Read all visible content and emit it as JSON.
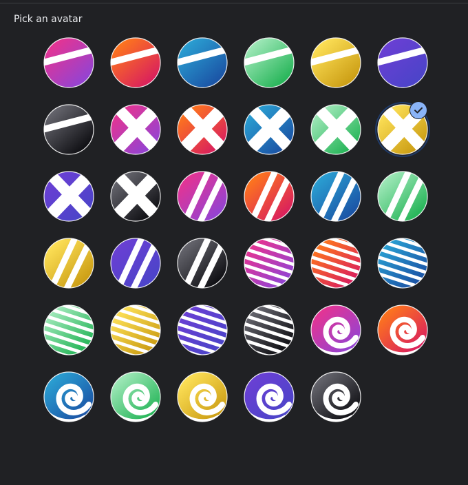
{
  "dialog": {
    "title": "Pick an avatar"
  },
  "colors": {
    "background": "#202124",
    "divider": "#3c4043",
    "title_text": "#e8eaed",
    "selection_ring": "#1f3b6b",
    "check_badge": "#8ab4f8"
  },
  "palettes": {
    "magenta": [
      "#e9338f",
      "#8e44d6"
    ],
    "red": [
      "#ff7a1a",
      "#d81b60"
    ],
    "blue": [
      "#2ba3d4",
      "#1a4fa3"
    ],
    "green": [
      "#a6ebbe",
      "#1fb253"
    ],
    "yellow": [
      "#ffe35a",
      "#c99a11"
    ],
    "violet": [
      "#6b3fd4",
      "#4a44c8"
    ],
    "black": [
      "#6a6a72",
      "#0b0b0f"
    ]
  },
  "avatars": [
    {
      "pattern": "diagonal-band",
      "palette": "magenta",
      "selected": false
    },
    {
      "pattern": "diagonal-band",
      "palette": "red",
      "selected": false
    },
    {
      "pattern": "diagonal-band",
      "palette": "blue",
      "selected": false
    },
    {
      "pattern": "diagonal-band",
      "palette": "green",
      "selected": false
    },
    {
      "pattern": "diagonal-band",
      "palette": "yellow",
      "selected": false
    },
    {
      "pattern": "diagonal-band",
      "palette": "violet",
      "selected": false
    },
    {
      "pattern": "diagonal-band",
      "palette": "black",
      "selected": false
    },
    {
      "pattern": "cross",
      "palette": "magenta",
      "selected": false
    },
    {
      "pattern": "cross",
      "palette": "red",
      "selected": false
    },
    {
      "pattern": "cross",
      "palette": "blue",
      "selected": false
    },
    {
      "pattern": "cross",
      "palette": "green",
      "selected": false
    },
    {
      "pattern": "cross",
      "palette": "yellow",
      "selected": true
    },
    {
      "pattern": "cross",
      "palette": "violet",
      "selected": false
    },
    {
      "pattern": "cross",
      "palette": "black",
      "selected": false
    },
    {
      "pattern": "double-stripe",
      "palette": "magenta",
      "selected": false
    },
    {
      "pattern": "double-stripe",
      "palette": "red",
      "selected": false
    },
    {
      "pattern": "double-stripe",
      "palette": "blue",
      "selected": false
    },
    {
      "pattern": "double-stripe",
      "palette": "green",
      "selected": false
    },
    {
      "pattern": "double-stripe",
      "palette": "yellow",
      "selected": false
    },
    {
      "pattern": "double-stripe",
      "palette": "violet",
      "selected": false
    },
    {
      "pattern": "double-stripe",
      "palette": "black",
      "selected": false
    },
    {
      "pattern": "many-stripes",
      "palette": "magenta",
      "selected": false
    },
    {
      "pattern": "many-stripes",
      "palette": "red",
      "selected": false
    },
    {
      "pattern": "many-stripes",
      "palette": "blue",
      "selected": false
    },
    {
      "pattern": "many-stripes",
      "palette": "green",
      "selected": false
    },
    {
      "pattern": "many-stripes",
      "palette": "yellow",
      "selected": false
    },
    {
      "pattern": "many-stripes",
      "palette": "violet",
      "selected": false
    },
    {
      "pattern": "many-stripes",
      "palette": "black",
      "selected": false
    },
    {
      "pattern": "swirl",
      "palette": "magenta",
      "selected": false
    },
    {
      "pattern": "swirl",
      "palette": "red",
      "selected": false
    },
    {
      "pattern": "swirl",
      "palette": "blue",
      "selected": false
    },
    {
      "pattern": "swirl",
      "palette": "green",
      "selected": false
    },
    {
      "pattern": "swirl",
      "palette": "yellow",
      "selected": false
    },
    {
      "pattern": "swirl",
      "palette": "violet",
      "selected": false
    },
    {
      "pattern": "swirl",
      "palette": "black",
      "selected": false
    }
  ]
}
